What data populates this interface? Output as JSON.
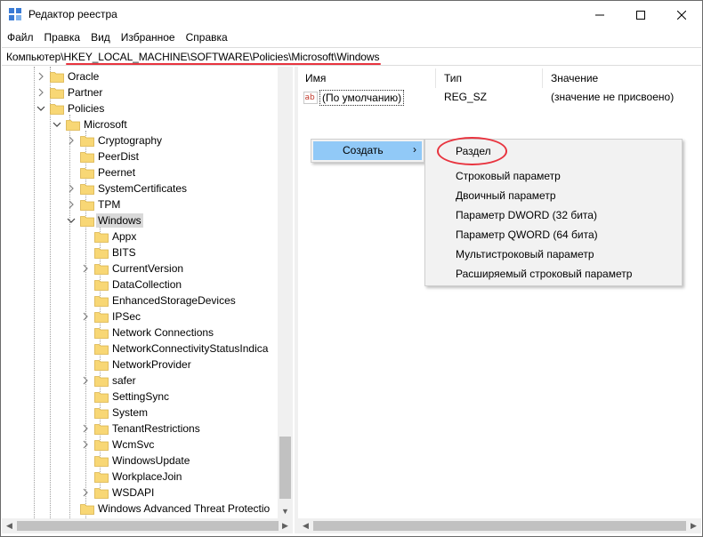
{
  "window": {
    "title": "Редактор реестра"
  },
  "menubar": {
    "items": [
      "Файл",
      "Правка",
      "Вид",
      "Избранное",
      "Справка"
    ]
  },
  "address": {
    "path": "Компьютер\\HKEY_LOCAL_MACHINE\\SOFTWARE\\Policies\\Microsoft\\Windows"
  },
  "tree": {
    "items": [
      {
        "label": "Oracle"
      },
      {
        "label": "Partner"
      },
      {
        "label": "Policies"
      },
      {
        "label": "Microsoft"
      },
      {
        "label": "Cryptography"
      },
      {
        "label": "PeerDist"
      },
      {
        "label": "Peernet"
      },
      {
        "label": "SystemCertificates"
      },
      {
        "label": "TPM"
      },
      {
        "label": "Windows"
      },
      {
        "label": "Appx"
      },
      {
        "label": "BITS"
      },
      {
        "label": "CurrentVersion"
      },
      {
        "label": "DataCollection"
      },
      {
        "label": "EnhancedStorageDevices"
      },
      {
        "label": "IPSec"
      },
      {
        "label": "Network Connections"
      },
      {
        "label": "NetworkConnectivityStatusIndica"
      },
      {
        "label": "NetworkProvider"
      },
      {
        "label": "safer"
      },
      {
        "label": "SettingSync"
      },
      {
        "label": "System"
      },
      {
        "label": "TenantRestrictions"
      },
      {
        "label": "WcmSvc"
      },
      {
        "label": "WindowsUpdate"
      },
      {
        "label": "WorkplaceJoin"
      },
      {
        "label": "WSDAPI"
      },
      {
        "label": "Windows Advanced Threat Protectio"
      }
    ]
  },
  "list": {
    "headers": {
      "name": "Имя",
      "type": "Тип",
      "data": "Значение"
    },
    "rows": [
      {
        "name": "(По умолчанию)",
        "type": "REG_SZ",
        "data": "(значение не присвоено)",
        "icon_text": "ab"
      }
    ]
  },
  "context_menu": {
    "create_label": "Создать",
    "create_arrow": "›",
    "submenu": [
      "Раздел",
      "Строковый параметр",
      "Двоичный параметр",
      "Параметр DWORD (32 бита)",
      "Параметр QWORD (64 бита)",
      "Мультистроковый параметр",
      "Расширяемый строковый параметр"
    ]
  },
  "colors": {
    "selection_gray": "#d9d9d9",
    "menu_highlight": "#91c9f7",
    "annotation_red": "#e8343f",
    "folder_yellow": "#f8d775"
  }
}
